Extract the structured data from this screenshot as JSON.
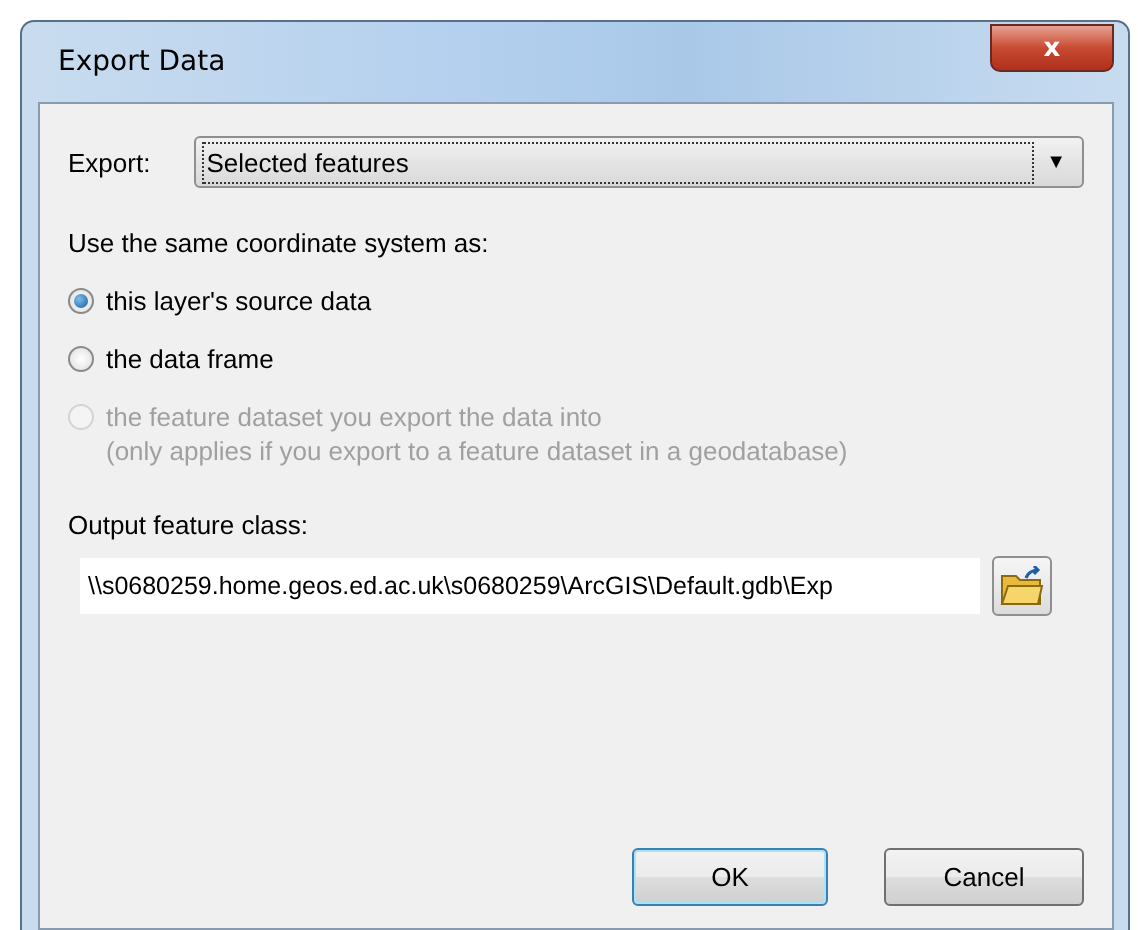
{
  "window": {
    "title": "Export Data",
    "close": "x"
  },
  "export": {
    "label": "Export:",
    "value": "Selected features",
    "arrow": "▼"
  },
  "coordinate_system": {
    "heading": "Use the same coordinate system as:",
    "options": [
      {
        "label": "this layer's source data",
        "selected": true,
        "disabled": false
      },
      {
        "label": "the data frame",
        "selected": false,
        "disabled": false
      },
      {
        "label": "the feature dataset you export the data into",
        "note": "(only applies if you export to a feature dataset in a geodatabase)",
        "selected": false,
        "disabled": true
      }
    ]
  },
  "output": {
    "label": "Output feature class:",
    "value": "\\\\s0680259.home.geos.ed.ac.uk\\s0680259\\ArcGIS\\Default.gdb\\Exp"
  },
  "buttons": [
    {
      "label": "OK",
      "default": true
    },
    {
      "label": "Cancel",
      "default": false
    }
  ]
}
